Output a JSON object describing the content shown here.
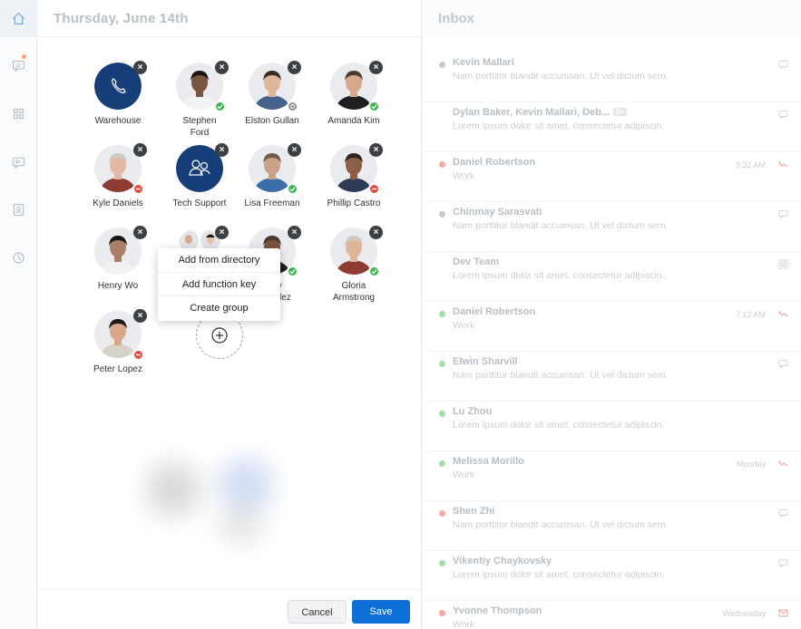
{
  "rail": {
    "items": [
      {
        "name": "home-icon",
        "active": true
      },
      {
        "name": "chat-icon",
        "active": false,
        "badge": true
      },
      {
        "name": "apps-grid-icon",
        "active": false
      },
      {
        "name": "video-chat-icon",
        "active": false
      },
      {
        "name": "contacts-icon",
        "active": false
      },
      {
        "name": "history-clock-icon",
        "active": false
      }
    ]
  },
  "center": {
    "date": "Thursday, June 14th",
    "tiles": [
      {
        "name": "Warehouse",
        "line2": "",
        "kind": "phone",
        "status": "none"
      },
      {
        "name": "Stephen",
        "line2": "Ford",
        "kind": "person",
        "status": "ok"
      },
      {
        "name": "Elston Gullan",
        "line2": "",
        "kind": "person",
        "status": "away"
      },
      {
        "name": "Amanda Kim",
        "line2": "",
        "kind": "person",
        "status": "ok"
      },
      {
        "name": "Kyle Daniels",
        "line2": "",
        "kind": "person",
        "status": "busy"
      },
      {
        "name": "Tech Support",
        "line2": "",
        "kind": "group",
        "status": "none"
      },
      {
        "name": "Lisa Freeman",
        "line2": "",
        "kind": "person",
        "status": "ok"
      },
      {
        "name": "Phillip Castro",
        "line2": "",
        "kind": "person",
        "status": "busy"
      },
      {
        "name": "Henry Wo",
        "line2": "",
        "kind": "person",
        "status": "none"
      },
      {
        "name": "",
        "line2": "",
        "kind": "duo",
        "status": "none"
      },
      {
        "name": "Gary",
        "line2": "ernandez",
        "kind": "person",
        "status": "ok"
      },
      {
        "name": "Gloria",
        "line2": "Armstrong",
        "kind": "person",
        "status": "ok"
      },
      {
        "name": "Peter Lopez",
        "line2": "",
        "kind": "person",
        "status": "busy"
      }
    ],
    "menu": [
      "Add from directory",
      "Add function key",
      "Create group"
    ],
    "cancel": "Cancel",
    "save": "Save"
  },
  "inbox": {
    "title": "Inbox",
    "rows": [
      {
        "title": "Kevin Mallari",
        "preview": "Nam porttitor blandit accumsan. Ut vel dictum sem.",
        "time": "",
        "dot": "gray",
        "icon": "chat-bubble-icon",
        "tag": ""
      },
      {
        "title": "Dylan Baker, Kevin Mallari, Deb...",
        "preview": "Lorem ipsum dolor sit amet, consectetur adipiscin.",
        "time": "",
        "dot": "none",
        "icon": "chat-bubble-icon",
        "tag": "8+"
      },
      {
        "title": "Daniel Robertson",
        "preview": "Work",
        "time": "9:32 AM",
        "dot": "red",
        "icon": "missed-call-icon",
        "tag": ""
      },
      {
        "title": "Chinmay Sarasvati",
        "preview": "Nam porttitor blandit accumsan. Ut vel dictum sem.",
        "time": "",
        "dot": "gray",
        "icon": "chat-bubble-icon",
        "tag": ""
      },
      {
        "title": "Dev Team",
        "preview": "Lorem ipsum dolor sit amet, consectetur adipiscin.",
        "time": "",
        "dot": "none",
        "icon": "grid-icon",
        "tag": ""
      },
      {
        "title": "Daniel Robertson",
        "preview": "Work",
        "time": "7:12 AM",
        "dot": "green",
        "icon": "missed-call-icon",
        "tag": ""
      },
      {
        "title": "Elwin Sharvill",
        "preview": "Nam porttitor blandit accumsan. Ut vel dictum sem.",
        "time": "",
        "dot": "green",
        "icon": "chat-bubble-icon",
        "tag": ""
      },
      {
        "title": "Lu Zhou",
        "preview": "Lorem ipsum dolor sit amet, consectetur adipiscin.",
        "time": "",
        "dot": "green",
        "icon": "",
        "tag": ""
      },
      {
        "title": "Melissa Morillo",
        "preview": "Work",
        "time": "Monday",
        "dot": "green",
        "icon": "missed-call-icon",
        "tag": ""
      },
      {
        "title": "Shen Zhi",
        "preview": "Nam porttitor blandit accumsan. Ut vel dictum sem.",
        "time": "",
        "dot": "red",
        "icon": "chat-bubble-icon",
        "tag": ""
      },
      {
        "title": "Vikentiy Chaykovsky",
        "preview": "Lorem ipsum dolor sit amet, consectetur adipiscin.",
        "time": "",
        "dot": "green",
        "icon": "chat-bubble-icon",
        "tag": ""
      },
      {
        "title": "Yvonne Thompson",
        "preview": "Work",
        "time": "Wednesday",
        "dot": "red",
        "icon": "voicemail-icon",
        "tag": ""
      }
    ]
  },
  "colors": {
    "accent": "#0e6fd6",
    "online": "#3bb54a",
    "busy": "#e34b3f"
  }
}
